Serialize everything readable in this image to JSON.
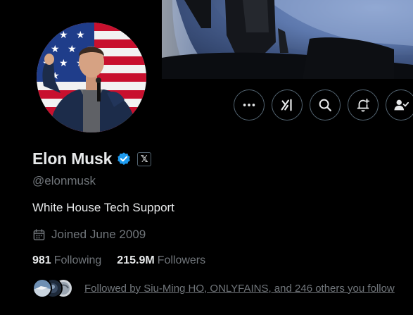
{
  "profile": {
    "display_name": "Elon Musk",
    "affiliation_badge": "𝕏",
    "handle": "@elonmusk",
    "bio": "White House Tech Support",
    "joined": "Joined June 2009"
  },
  "stats": {
    "following_count": "981",
    "following_label": "Following",
    "followers_count": "215.9M",
    "followers_label": "Followers"
  },
  "followed_by": {
    "text": "Followed by Siu-Ming HO, ONLYFAINS, and 246 others you follow"
  },
  "actions": [
    {
      "icon": "more-icon"
    },
    {
      "icon": "grok-icon"
    },
    {
      "icon": "search-icon"
    },
    {
      "icon": "notification-bell-icon"
    },
    {
      "icon": "following-user-icon"
    }
  ],
  "colors": {
    "background": "#000000",
    "primary_text": "#e7e9ea",
    "secondary_text": "#71767b",
    "verified_blue": "#1d9bf0",
    "button_border": "#536471"
  }
}
